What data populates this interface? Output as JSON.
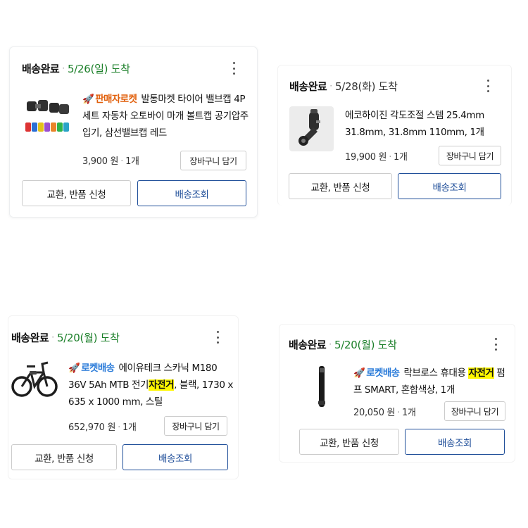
{
  "colors": {
    "green_date": "#1a7f28",
    "rocket_blue": "#2a7bd9",
    "seller_rocket_orange": "#e15f0b",
    "track_blue": "#1f4e99",
    "highlight": "#fff700"
  },
  "orders": [
    {
      "status": "배송완료",
      "date": "5/26(일) 도착",
      "badge": "판매자로켓",
      "title": "발통마켓 타이어 밸브캡 4P 세트 자동차 오토바이 마개 볼트캡 공기압주입기, 삼선밸브캡 레드",
      "price": "3,900 원",
      "qty": "1개",
      "cart": "장바구니 담기",
      "return": "교환, 반품 신청",
      "track": "배송조회",
      "icon": "valve-caps-image"
    },
    {
      "status": "배송완료",
      "date": "5/28(화) 도착",
      "title": "에코하이진 각도조절 스템 25.4mm 31.8mm, 31.8mm 110mm, 1개",
      "price": "19,900 원",
      "qty": "1개",
      "cart": "장바구니 담기",
      "return": "교환, 반품 신청",
      "track": "배송조회",
      "icon": "stem-image"
    },
    {
      "status": "배송완료",
      "date": "5/20(월) 도착",
      "badge": "로켓배송",
      "title_before": "에이유테크 스카닉 M180 36V 5Ah MTB 전기",
      "title_hl": "자전거",
      "title_after": ", 블랙, 1730 x 635 x 1000 mm, 스틸",
      "price": "652,970 원",
      "qty": "1개",
      "cart": "장바구니 담기",
      "return": "교환, 반품 신청",
      "track": "배송조회",
      "icon": "ebike-image"
    },
    {
      "status": "배송완료",
      "date": "5/20(월) 도착",
      "badge": "로켓배송",
      "title_before": "락브로스 휴대용 ",
      "title_hl": "자전거",
      "title_after": " 펌프 SMART, 혼합색상, 1개",
      "price": "20,050 원",
      "qty": "1개",
      "cart": "장바구니 담기",
      "return": "교환, 반품 신청",
      "track": "배송조회",
      "icon": "pump-image"
    }
  ]
}
